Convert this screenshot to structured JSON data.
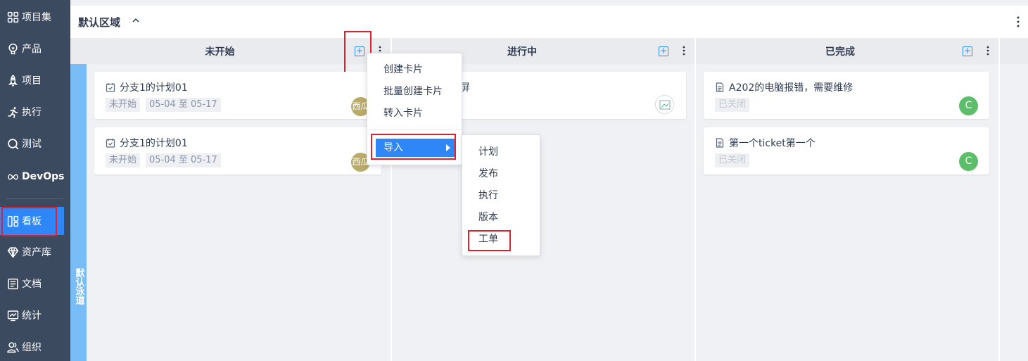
{
  "sidebar": {
    "items": [
      {
        "label": "项目集",
        "icon": "grid-icon"
      },
      {
        "label": "产品",
        "icon": "bulb-icon"
      },
      {
        "label": "项目",
        "icon": "rocket-icon"
      },
      {
        "label": "执行",
        "icon": "run-icon"
      },
      {
        "label": "测试",
        "icon": "magnifier-icon"
      },
      {
        "label": "DevOps",
        "icon": "infinity-icon"
      },
      {
        "label": "看板",
        "icon": "kanban-icon"
      },
      {
        "label": "资产库",
        "icon": "diamond-icon"
      },
      {
        "label": "文档",
        "icon": "doc-icon"
      },
      {
        "label": "统计",
        "icon": "chart-icon"
      },
      {
        "label": "组织",
        "icon": "people-icon"
      }
    ],
    "active": "看板"
  },
  "region": {
    "title": "默认区域"
  },
  "lane": {
    "label": "默认泳道"
  },
  "columns": [
    {
      "title": "未开始"
    },
    {
      "title": "进行中"
    },
    {
      "title": "已完成"
    }
  ],
  "cards": {
    "todo": [
      {
        "title": "分支1的计划01",
        "status": "未开始",
        "dates": "05-04 至 05-17",
        "avatar": "西瓜"
      },
      {
        "title": "分支1的计划01",
        "status": "未开始",
        "dates": "05-04 至 05-17",
        "avatar": "西瓜"
      }
    ],
    "doing": [
      {
        "title_fragment": "屏"
      }
    ],
    "done": [
      {
        "title": "A202的电脑报错，需要维修",
        "status": "已关闭",
        "avatar": "C"
      },
      {
        "title": "第一个ticket第一个",
        "status": "已关闭",
        "avatar": "C"
      }
    ]
  },
  "context_menu": {
    "items": [
      "创建卡片",
      "批量创建卡片",
      "转入卡片"
    ],
    "import": "导入"
  },
  "submenu": {
    "items": [
      "计划",
      "发布",
      "执行",
      "版本",
      "工单"
    ]
  },
  "colors": {
    "sidebar_bg": "#3c4a60",
    "accent": "#2f86f6",
    "lane_strip": "#79bdf6",
    "highlight_box": "#e0202a",
    "avatar_green": "#5cbd6a",
    "avatar_olive": "#b9ab6a"
  }
}
